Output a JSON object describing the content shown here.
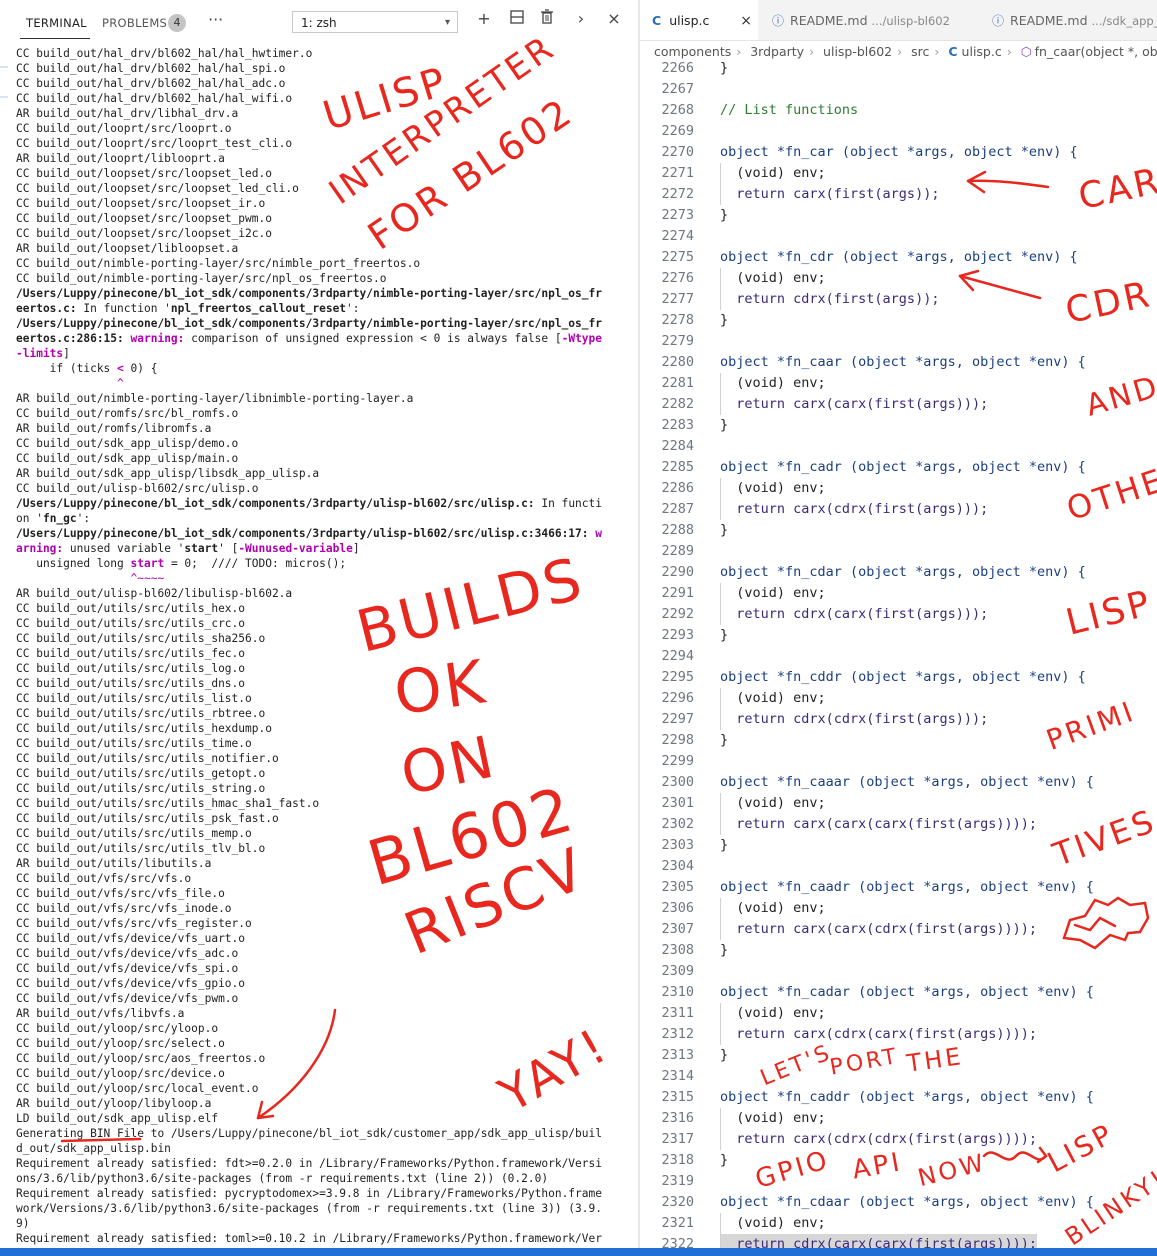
{
  "terminal": {
    "tabs": [
      {
        "label": "TERMINAL",
        "active": true
      },
      {
        "label": "PROBLEMS",
        "active": false
      }
    ],
    "problems_count": "4",
    "more_icon": "ellipsis-icon",
    "shell_selector": "1: zsh",
    "actions": [
      "plus-icon",
      "split-icon",
      "trash-icon",
      "chevron-right-icon",
      "close-icon"
    ],
    "lines": [
      {
        "t": "CC build_out/hal_drv/bl602_hal/hal_hwtimer.o"
      },
      {
        "t": "CC build_out/hal_drv/bl602_hal/hal_spi.o"
      },
      {
        "t": "CC build_out/hal_drv/bl602_hal/hal_adc.o"
      },
      {
        "t": "CC build_out/hal_drv/bl602_hal/hal_wifi.o"
      },
      {
        "t": "AR build_out/hal_drv/libhal_drv.a"
      },
      {
        "t": "CC build_out/looprt/src/looprt.o"
      },
      {
        "t": "CC build_out/looprt/src/looprt_test_cli.o"
      },
      {
        "t": "AR build_out/looprt/liblooprt.a"
      },
      {
        "t": "CC build_out/loopset/src/loopset_led.o"
      },
      {
        "t": "CC build_out/loopset/src/loopset_led_cli.o"
      },
      {
        "t": "CC build_out/loopset/src/loopset_ir.o"
      },
      {
        "t": "CC build_out/loopset/src/loopset_pwm.o"
      },
      {
        "t": "CC build_out/loopset/src/loopset_i2c.o"
      },
      {
        "t": "AR build_out/loopset/libloopset.a"
      },
      {
        "t": "CC build_out/nimble-porting-layer/src/nimble_port_freertos.o"
      },
      {
        "t": "CC build_out/nimble-porting-layer/src/npl_os_freertos.o"
      },
      {
        "t": "/Users/Luppy/pinecone/bl_iot_sdk/components/3rdparty/nimble-porting-layer/src/npl_os_fr",
        "s": "path"
      },
      {
        "parts": [
          {
            "t": "eertos.c:",
            "s": "path"
          },
          {
            "t": " In function '"
          },
          {
            "t": "npl_freertos_callout_reset",
            "s": "path"
          },
          {
            "t": "':"
          }
        ]
      },
      {
        "t": "/Users/Luppy/pinecone/bl_iot_sdk/components/3rdparty/nimble-porting-layer/src/npl_os_fr",
        "s": "path"
      },
      {
        "parts": [
          {
            "t": "eertos.c:286:15: ",
            "s": "path"
          },
          {
            "t": "warning:",
            "s": "warn"
          },
          {
            "t": " comparison of unsigned expression < 0 is always false ["
          },
          {
            "t": "-Wtype",
            "s": "warn"
          }
        ]
      },
      {
        "parts": [
          {
            "t": "-limits",
            "s": "warn"
          },
          {
            "t": "]"
          }
        ]
      },
      {
        "parts": [
          {
            "t": "     if (ticks "
          },
          {
            "t": "<",
            "s": "warn"
          },
          {
            "t": " 0) {"
          }
        ]
      },
      {
        "parts": [
          {
            "t": "               "
          },
          {
            "t": "^",
            "s": "mag"
          }
        ]
      },
      {
        "t": "AR build_out/nimble-porting-layer/libnimble-porting-layer.a"
      },
      {
        "t": "CC build_out/romfs/src/bl_romfs.o"
      },
      {
        "t": "AR build_out/romfs/libromfs.a"
      },
      {
        "t": "CC build_out/sdk_app_ulisp/demo.o"
      },
      {
        "t": "CC build_out/sdk_app_ulisp/main.o"
      },
      {
        "t": "AR build_out/sdk_app_ulisp/libsdk_app_ulisp.a"
      },
      {
        "t": "CC build_out/ulisp-bl602/src/ulisp.o"
      },
      {
        "parts": [
          {
            "t": "/Users/Luppy/pinecone/bl_iot_sdk/components/3rdparty/ulisp-bl602/src/ulisp.c:",
            "s": "path"
          },
          {
            "t": " In functi"
          }
        ]
      },
      {
        "parts": [
          {
            "t": "on '"
          },
          {
            "t": "fn_gc",
            "s": "path"
          },
          {
            "t": "':"
          }
        ]
      },
      {
        "parts": [
          {
            "t": "/Users/Luppy/pinecone/bl_iot_sdk/components/3rdparty/ulisp-bl602/src/ulisp.c:3466:17: ",
            "s": "path"
          },
          {
            "t": "w",
            "s": "warn"
          }
        ]
      },
      {
        "parts": [
          {
            "t": "arning:",
            "s": "warn"
          },
          {
            "t": " unused variable '"
          },
          {
            "t": "start",
            "s": "path"
          },
          {
            "t": "' ["
          },
          {
            "t": "-Wunused-variable",
            "s": "warn"
          },
          {
            "t": "]"
          }
        ]
      },
      {
        "parts": [
          {
            "t": "   unsigned long "
          },
          {
            "t": "start",
            "s": "warn"
          },
          {
            "t": " = 0;  //// TODO: micros();"
          }
        ]
      },
      {
        "parts": [
          {
            "t": "                 "
          },
          {
            "t": "^~~~~",
            "s": "mag"
          }
        ]
      },
      {
        "t": "AR build_out/ulisp-bl602/libulisp-bl602.a"
      },
      {
        "t": "CC build_out/utils/src/utils_hex.o"
      },
      {
        "t": "CC build_out/utils/src/utils_crc.o"
      },
      {
        "t": "CC build_out/utils/src/utils_sha256.o"
      },
      {
        "t": "CC build_out/utils/src/utils_fec.o"
      },
      {
        "t": "CC build_out/utils/src/utils_log.o"
      },
      {
        "t": "CC build_out/utils/src/utils_dns.o"
      },
      {
        "t": "CC build_out/utils/src/utils_list.o"
      },
      {
        "t": "CC build_out/utils/src/utils_rbtree.o"
      },
      {
        "t": "CC build_out/utils/src/utils_hexdump.o"
      },
      {
        "t": "CC build_out/utils/src/utils_time.o"
      },
      {
        "t": "CC build_out/utils/src/utils_notifier.o"
      },
      {
        "t": "CC build_out/utils/src/utils_getopt.o"
      },
      {
        "t": "CC build_out/utils/src/utils_string.o"
      },
      {
        "t": "CC build_out/utils/src/utils_hmac_sha1_fast.o"
      },
      {
        "t": "CC build_out/utils/src/utils_psk_fast.o"
      },
      {
        "t": "CC build_out/utils/src/utils_memp.o"
      },
      {
        "t": "CC build_out/utils/src/utils_tlv_bl.o"
      },
      {
        "t": "AR build_out/utils/libutils.a"
      },
      {
        "t": "CC build_out/vfs/src/vfs.o"
      },
      {
        "t": "CC build_out/vfs/src/vfs_file.o"
      },
      {
        "t": "CC build_out/vfs/src/vfs_inode.o"
      },
      {
        "t": "CC build_out/vfs/src/vfs_register.o"
      },
      {
        "t": "CC build_out/vfs/device/vfs_uart.o"
      },
      {
        "t": "CC build_out/vfs/device/vfs_adc.o"
      },
      {
        "t": "CC build_out/vfs/device/vfs_spi.o"
      },
      {
        "t": "CC build_out/vfs/device/vfs_gpio.o"
      },
      {
        "t": "CC build_out/vfs/device/vfs_pwm.o"
      },
      {
        "t": "AR build_out/vfs/libvfs.a"
      },
      {
        "t": "CC build_out/yloop/src/yloop.o"
      },
      {
        "t": "CC build_out/yloop/src/select.o"
      },
      {
        "t": "CC build_out/yloop/src/aos_freertos.o"
      },
      {
        "t": "CC build_out/yloop/src/device.o"
      },
      {
        "t": "CC build_out/yloop/src/local_event.o"
      },
      {
        "t": "AR build_out/yloop/libyloop.a"
      },
      {
        "t": "LD build_out/sdk_app_ulisp.elf"
      },
      {
        "t": "Generating BIN File to /Users/Luppy/pinecone/bl_iot_sdk/customer_app/sdk_app_ulisp/buil"
      },
      {
        "t": "d_out/sdk_app_ulisp.bin"
      },
      {
        "t": "Requirement already satisfied: fdt>=0.2.0 in /Library/Frameworks/Python.framework/Versi"
      },
      {
        "t": "ons/3.6/lib/python3.6/site-packages (from -r requirements.txt (line 2)) (0.2.0)"
      },
      {
        "t": "Requirement already satisfied: pycryptodomex>=3.9.8 in /Library/Frameworks/Python.frame"
      },
      {
        "t": "work/Versions/3.6/lib/python3.6/site-packages (from -r requirements.txt (line 3)) (3.9."
      },
      {
        "t": "9)"
      },
      {
        "t": "Requirement already satisfied: toml>=0.10.2 in /Library/Frameworks/Python.framework/Ver"
      }
    ]
  },
  "editor": {
    "tabs": [
      {
        "icon": "C",
        "label": "ulisp.c",
        "path": "",
        "active": true,
        "close": "×"
      },
      {
        "icon": "ⓘ",
        "label": "README.md",
        "path": ".../ulisp-bl602",
        "active": false,
        "close": ""
      },
      {
        "icon": "ⓘ",
        "label": "README.md",
        "path": ".../sdk_app_",
        "active": false,
        "close": ""
      }
    ],
    "breadcrumb": [
      "components",
      "3rdparty",
      "ulisp-bl602",
      "src",
      "ulisp.c",
      "fn_caar(object *, obje"
    ],
    "lines": [
      {
        "n": "2266",
        "t": "}"
      },
      {
        "n": "2267",
        "t": ""
      },
      {
        "n": "2268",
        "t": "// List functions"
      },
      {
        "n": "2269",
        "t": ""
      },
      {
        "n": "2270",
        "t": "object *fn_car (object *args, object *env) {"
      },
      {
        "n": "2271",
        "t": "  (void) env;"
      },
      {
        "n": "2272",
        "t": "  return carx(first(args));"
      },
      {
        "n": "2273",
        "t": "}"
      },
      {
        "n": "2274",
        "t": ""
      },
      {
        "n": "2275",
        "t": "object *fn_cdr (object *args, object *env) {"
      },
      {
        "n": "2276",
        "t": "  (void) env;"
      },
      {
        "n": "2277",
        "t": "  return cdrx(first(args));"
      },
      {
        "n": "2278",
        "t": "}"
      },
      {
        "n": "2279",
        "t": ""
      },
      {
        "n": "2280",
        "t": "object *fn_caar (object *args, object *env) {"
      },
      {
        "n": "2281",
        "t": "  (void) env;"
      },
      {
        "n": "2282",
        "t": "  return carx(carx(first(args)));"
      },
      {
        "n": "2283",
        "t": "}"
      },
      {
        "n": "2284",
        "t": ""
      },
      {
        "n": "2285",
        "t": "object *fn_cadr (object *args, object *env) {"
      },
      {
        "n": "2286",
        "t": "  (void) env;"
      },
      {
        "n": "2287",
        "t": "  return carx(cdrx(first(args)));"
      },
      {
        "n": "2288",
        "t": "}"
      },
      {
        "n": "2289",
        "t": ""
      },
      {
        "n": "2290",
        "t": "object *fn_cdar (object *args, object *env) {"
      },
      {
        "n": "2291",
        "t": "  (void) env;"
      },
      {
        "n": "2292",
        "t": "  return cdrx(carx(first(args)));"
      },
      {
        "n": "2293",
        "t": "}"
      },
      {
        "n": "2294",
        "t": ""
      },
      {
        "n": "2295",
        "t": "object *fn_cddr (object *args, object *env) {"
      },
      {
        "n": "2296",
        "t": "  (void) env;"
      },
      {
        "n": "2297",
        "t": "  return cdrx(cdrx(first(args)));"
      },
      {
        "n": "2298",
        "t": "}"
      },
      {
        "n": "2299",
        "t": ""
      },
      {
        "n": "2300",
        "t": "object *fn_caaar (object *args, object *env) {"
      },
      {
        "n": "2301",
        "t": "  (void) env;"
      },
      {
        "n": "2302",
        "t": "  return carx(carx(carx(first(args))));"
      },
      {
        "n": "2303",
        "t": "}"
      },
      {
        "n": "2304",
        "t": ""
      },
      {
        "n": "2305",
        "t": "object *fn_caadr (object *args, object *env) {"
      },
      {
        "n": "2306",
        "t": "  (void) env;"
      },
      {
        "n": "2307",
        "t": "  return carx(carx(cdrx(first(args))));"
      },
      {
        "n": "2308",
        "t": "}"
      },
      {
        "n": "2309",
        "t": ""
      },
      {
        "n": "2310",
        "t": "object *fn_cadar (object *args, object *env) {"
      },
      {
        "n": "2311",
        "t": "  (void) env;"
      },
      {
        "n": "2312",
        "t": "  return carx(cdrx(carx(first(args))));"
      },
      {
        "n": "2313",
        "t": "}"
      },
      {
        "n": "2314",
        "t": ""
      },
      {
        "n": "2315",
        "t": "object *fn_caddr (object *args, object *env) {"
      },
      {
        "n": "2316",
        "t": "  (void) env;"
      },
      {
        "n": "2317",
        "t": "  return carx(cdrx(cdrx(first(args))));"
      },
      {
        "n": "2318",
        "t": "}"
      },
      {
        "n": "2319",
        "t": ""
      },
      {
        "n": "2320",
        "t": "object *fn_cdaar (object *args, object *env) {"
      },
      {
        "n": "2321",
        "t": "  (void) env;"
      },
      {
        "n": "2322",
        "t": "  return cdrx(carx(carx(first(args))));"
      }
    ]
  },
  "annotations": {
    "ulisp": "ULISP",
    "interpreter": "INTERPRETER",
    "for_bl602": "FOR BL602",
    "builds": "BUILDS",
    "ok": "OK",
    "on": "ON",
    "bl602": "BL602",
    "riscv": "RISCV",
    "yay": "YAY!",
    "car": "CAR",
    "cdr": "CDR",
    "and": "AND",
    "other": "OTHER",
    "lisp": "LISP",
    "primi": "PRIMI",
    "tives": "TIVES",
    "lets": "LET'S",
    "port": "PORT",
    "the": "THE",
    "gpio": "GPIO",
    "api": "API",
    "now": "NOW",
    "lisp2": "LISP",
    "blinky": "BLINKY!"
  },
  "colors": {
    "annotation": "#e8281e",
    "status_bar": "#1f6fd6"
  }
}
